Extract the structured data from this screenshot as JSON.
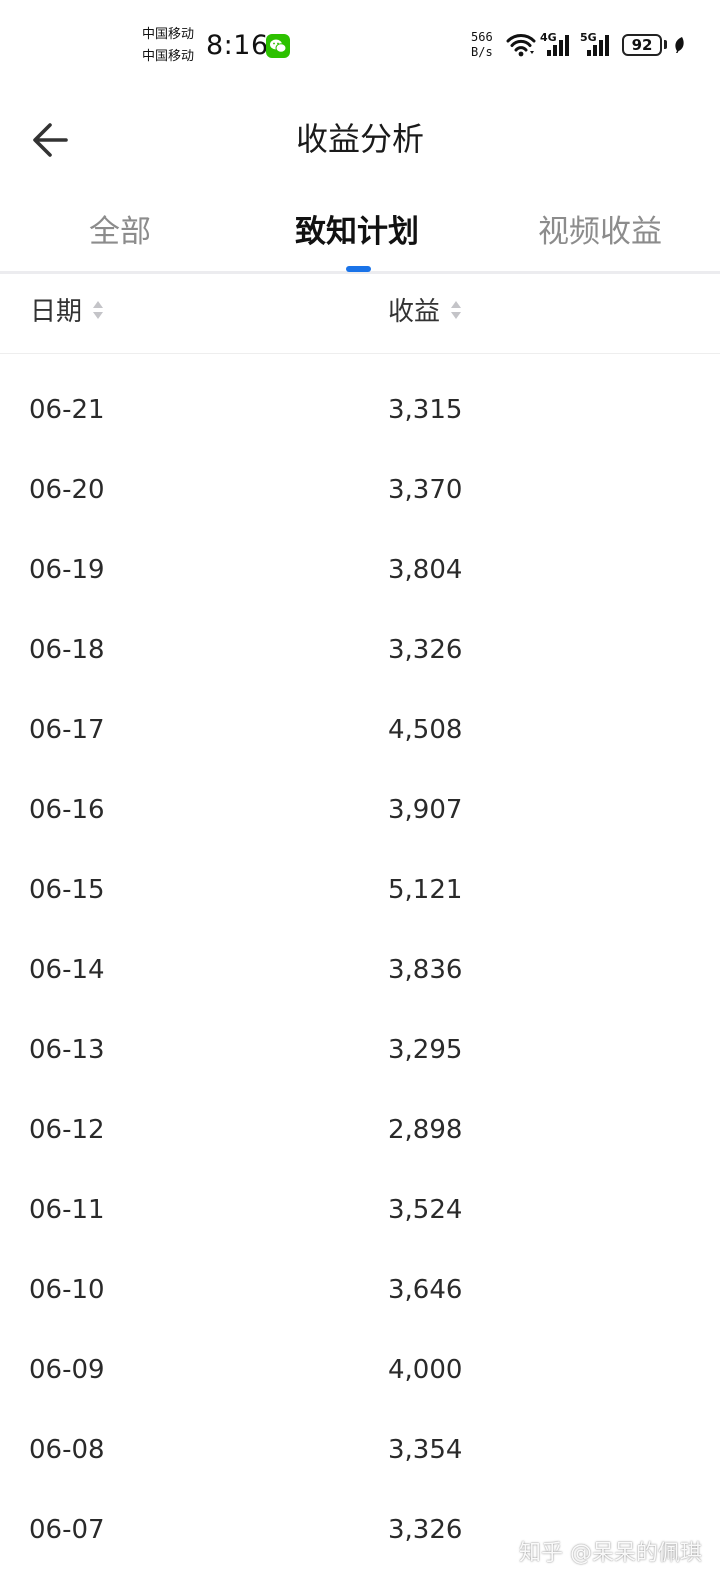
{
  "status_bar": {
    "carrier_1": "中国移动",
    "carrier_2": "中国移动",
    "time": "8:16",
    "net_speed_value": "566",
    "net_speed_unit": "B/s",
    "sim1_network": "4G",
    "sim2_network": "5G",
    "battery_level": "92",
    "icons": [
      "wechat-icon",
      "wifi-icon",
      "signal-icon",
      "battery-icon",
      "leaf-icon"
    ]
  },
  "header": {
    "back_icon": "arrow-left-icon",
    "title": "收益分析"
  },
  "tabs": [
    {
      "label": "全部",
      "selected": false
    },
    {
      "label": "致知计划",
      "selected": true
    },
    {
      "label": "视频收益",
      "selected": false
    }
  ],
  "table": {
    "columns": [
      {
        "label": "日期",
        "sort_icon": "sort-icon"
      },
      {
        "label": "收益",
        "sort_icon": "sort-icon"
      }
    ],
    "rows": [
      {
        "date": "06-21",
        "income": "3,315"
      },
      {
        "date": "06-20",
        "income": "3,370"
      },
      {
        "date": "06-19",
        "income": "3,804"
      },
      {
        "date": "06-18",
        "income": "3,326"
      },
      {
        "date": "06-17",
        "income": "4,508"
      },
      {
        "date": "06-16",
        "income": "3,907"
      },
      {
        "date": "06-15",
        "income": "5,121"
      },
      {
        "date": "06-14",
        "income": "3,836"
      },
      {
        "date": "06-13",
        "income": "3,295"
      },
      {
        "date": "06-12",
        "income": "2,898"
      },
      {
        "date": "06-11",
        "income": "3,524"
      },
      {
        "date": "06-10",
        "income": "3,646"
      },
      {
        "date": "06-09",
        "income": "4,000"
      },
      {
        "date": "06-08",
        "income": "3,354"
      },
      {
        "date": "06-07",
        "income": "3,326"
      }
    ]
  },
  "watermark": "知乎 @呆呆的佩琪",
  "colors": {
    "accent": "#1a73e8",
    "tab_inactive": "#8c8c8c",
    "text": "#222222",
    "wechat_green": "#2dc100"
  }
}
